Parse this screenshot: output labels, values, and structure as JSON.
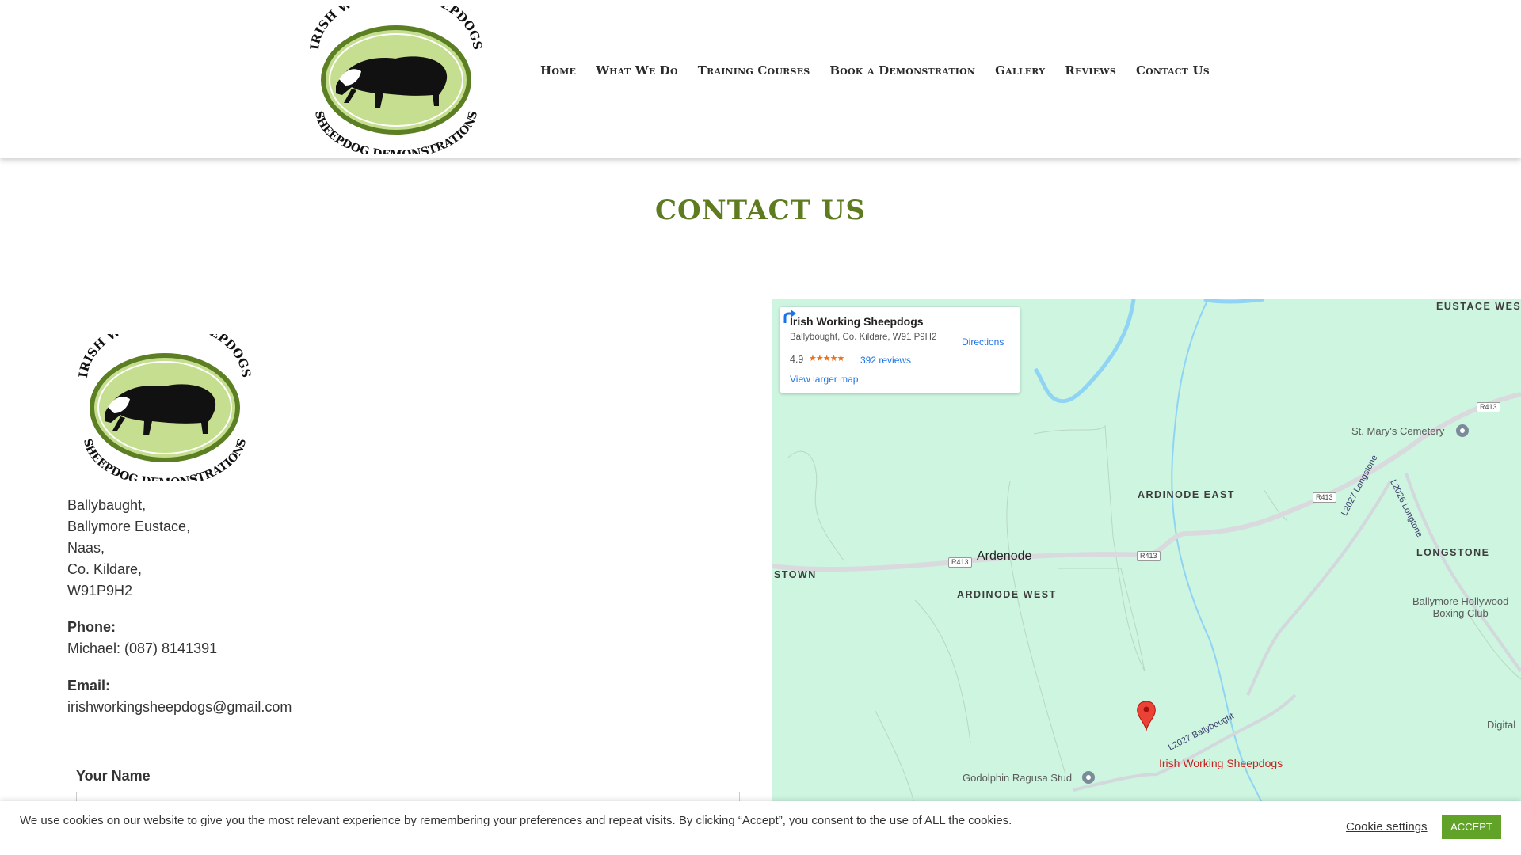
{
  "logo": {
    "top_text": "IRISH WORKING SHEEPDOGS",
    "bottom_text": "SHEEPDOG DEMONSTRATIONS"
  },
  "nav": {
    "items": [
      "Home",
      "What We Do",
      "Training Courses",
      "Book a Demonstration",
      "Gallery",
      "Reviews",
      "Contact Us"
    ]
  },
  "page": {
    "title": "CONTACT US"
  },
  "contact": {
    "address": [
      "Ballybaught,",
      "Ballymore Eustace,",
      "Naas,",
      "Co. Kildare,",
      "W91P9H2"
    ],
    "phone_label": "Phone:",
    "phone_value": "Michael: (087) 8141391",
    "email_label": "Email:",
    "email_value": "irishworkingsheepdogs@gmail.com"
  },
  "form": {
    "name_label": "Your Name"
  },
  "map": {
    "card": {
      "name": "Irish Working Sheepdogs",
      "address": "Ballybought, Co. Kildare, W91 P9H2",
      "rating": "4.9",
      "stars": "★★★★★",
      "reviews": "392 reviews",
      "larger_map": "View larger map",
      "directions": "Directions"
    },
    "labels": {
      "eustace_west": "EUSTACE WEST",
      "st_marys": "St. Mary's Cemetery",
      "ardinode_east": "ARDINODE EAST",
      "ardenode": "Ardenode",
      "ardinode_west": "ARDINODE WEST",
      "stown": "STOWN",
      "longstone": "LONGSTONE",
      "ballymore_boxing_1": "Ballymore Hollywood",
      "ballymore_boxing_2": "Boxing Club",
      "digital": "Digital",
      "godolphin": "Godolphin Ragusa Stud",
      "pin_label": "Irish Working Sheepdogs",
      "road_l2027_longstone": "L2027 Longstone",
      "road_l2026_longtone": "L2026 Longtone",
      "road_l2027_ballybought": "L2027 Ballybought",
      "r413": "R413"
    },
    "colors": {
      "land": "#cdf5e0",
      "water": "#8fd3f5",
      "road": "#d9d9de",
      "pin": "#ea4335"
    }
  },
  "cookie": {
    "text": "We use cookies on our website to give you the most relevant experience by remembering your preferences and repeat visits. By clicking “Accept”, you consent to the use of ALL the cookies.",
    "settings": "Cookie settings",
    "accept": "ACCEPT"
  },
  "colors": {
    "title_green": "#5e7b1f",
    "accept_green": "#61a229"
  }
}
